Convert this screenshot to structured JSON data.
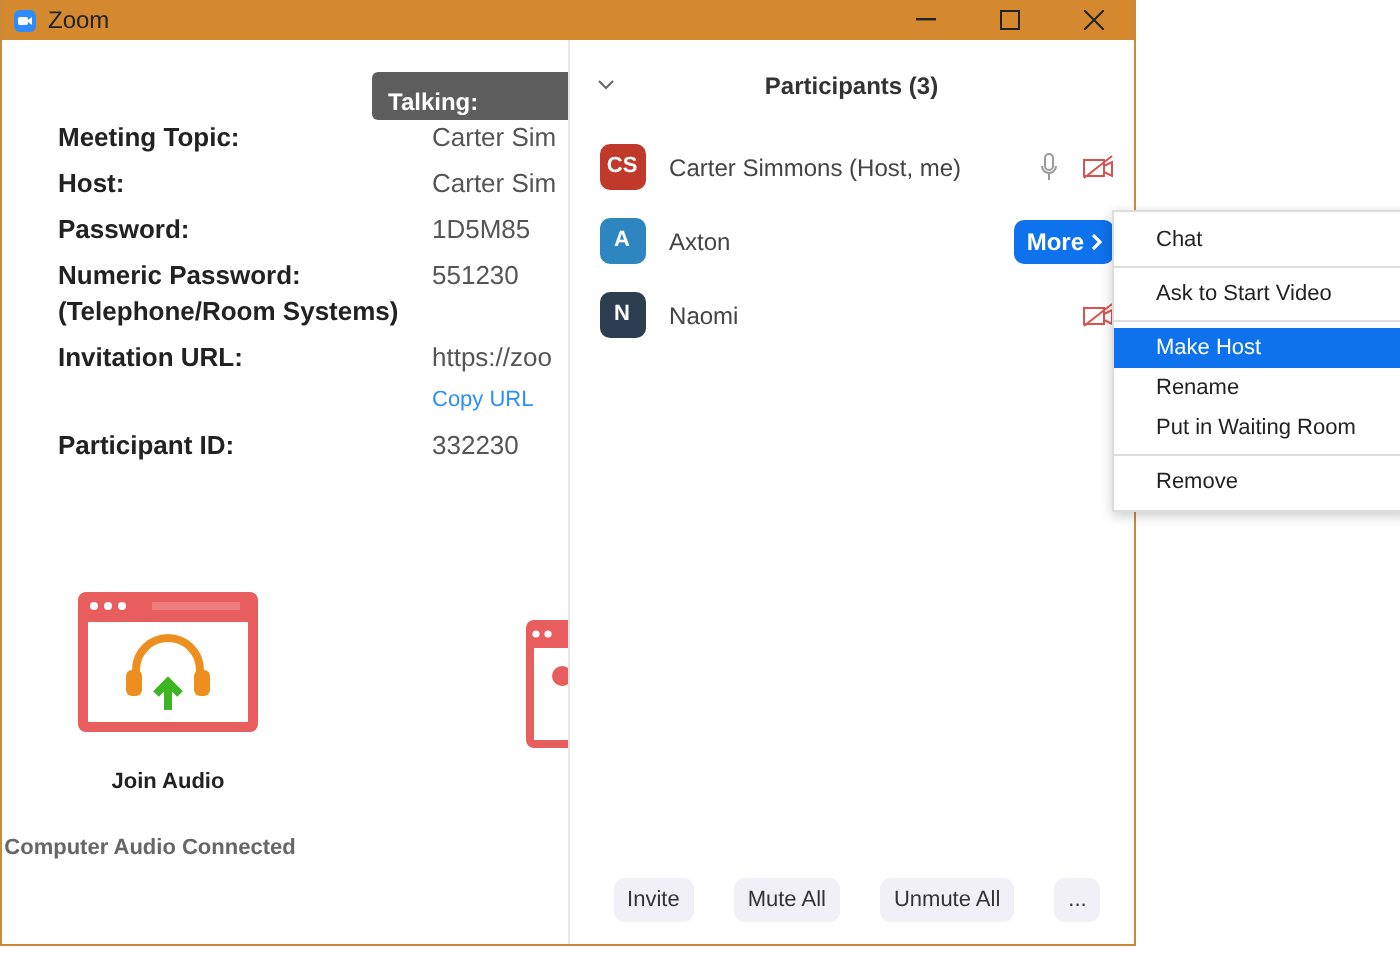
{
  "window": {
    "title": "Zoom"
  },
  "talking_tooltip": "Talking:",
  "meeting_info": [
    {
      "label": "Meeting Topic:",
      "value": "Carter Sim"
    },
    {
      "label": "Host:",
      "value": "Carter Sim"
    },
    {
      "label": "Password:",
      "value": "1D5M85"
    },
    {
      "label": "Numeric Password:\n(Telephone/Room Systems)",
      "value": "551230"
    },
    {
      "label": "Invitation URL:",
      "value": "https://zoo",
      "link": "Copy URL"
    },
    {
      "label": "Participant ID:",
      "value": "332230"
    }
  ],
  "audio": {
    "label": "Join Audio",
    "status": "Computer Audio Connected"
  },
  "participants": {
    "title": "Participants (3)",
    "items": [
      {
        "initials": "CS",
        "name": "Carter Simmons (Host, me)",
        "color": "#c0392b",
        "mic": true,
        "video_off": true
      },
      {
        "initials": "A",
        "name": "Axton",
        "color": "#2e86c1",
        "mic": false,
        "video_off": false,
        "more_button": "More"
      },
      {
        "initials": "N",
        "name": "Naomi",
        "color": "#2c3e50",
        "mic": false,
        "video_off": true
      }
    ]
  },
  "context_menu": [
    {
      "kind": "item",
      "label": "Chat",
      "selected": false
    },
    {
      "kind": "divider"
    },
    {
      "kind": "item",
      "label": "Ask to Start Video",
      "selected": false
    },
    {
      "kind": "divider"
    },
    {
      "kind": "item",
      "label": "Make Host",
      "selected": true
    },
    {
      "kind": "item",
      "label": "Rename",
      "selected": false
    },
    {
      "kind": "item",
      "label": "Put in Waiting Room",
      "selected": false
    },
    {
      "kind": "divider"
    },
    {
      "kind": "item",
      "label": "Remove",
      "selected": false
    }
  ],
  "footer_buttons": [
    "Invite",
    "Mute All",
    "Unmute All",
    "..."
  ]
}
